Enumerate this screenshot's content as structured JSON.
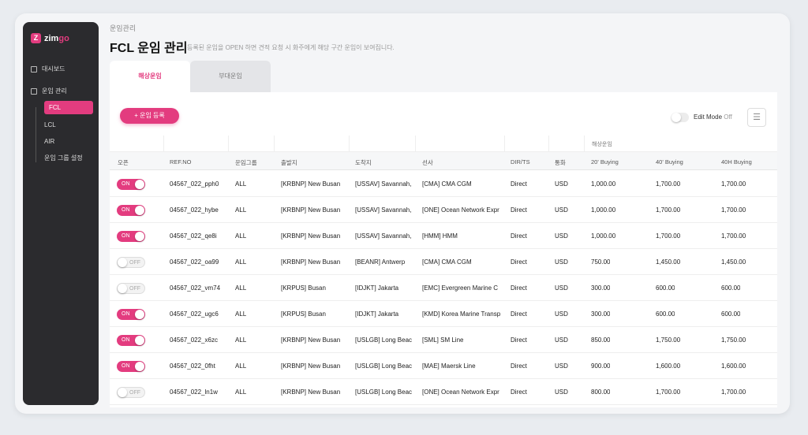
{
  "sidebar": {
    "logo_mark": "Z",
    "logo_text": "zim",
    "logo_suffix": "go",
    "dashboard": "대시보드",
    "rate_mgmt": "운임 관리",
    "sub_items": [
      "FCL",
      "LCL",
      "AIR",
      "운임 그룹 설정"
    ]
  },
  "breadcrumb": "운임관리",
  "title": "FCL 운임 관리",
  "subtitle": "등록된 운임을 OPEN 하면 견적 요청 시 화주에게 해당 구간 운임이 보여집니다.",
  "tabs": [
    "해상운임",
    "부대운임"
  ],
  "add_button": "+ 운임 등록",
  "edit_mode": {
    "label": "Edit Mode",
    "state": "Off"
  },
  "table": {
    "group_header": "해상운임",
    "columns": [
      "오픈",
      "REF.NO",
      "운임그룹",
      "출발지",
      "도착지",
      "선사",
      "DIR/TS",
      "통화",
      "20' Buying",
      "40' Buying",
      "40H Buying"
    ],
    "rows": [
      {
        "open": "ON",
        "ref": "04567_022_pph0",
        "group": "ALL",
        "origin": "[KRBNP] New Busan",
        "dest": "[USSAV] Savannah,",
        "carrier": "[CMA] CMA CGM",
        "dir": "Direct",
        "cur": "USD",
        "b20": "1,000.00",
        "b40": "1,700.00",
        "b40h": "1,700.00"
      },
      {
        "open": "ON",
        "ref": "04567_022_hybe",
        "group": "ALL",
        "origin": "[KRBNP] New Busan",
        "dest": "[USSAV] Savannah,",
        "carrier": "[ONE] Ocean Network Expr",
        "dir": "Direct",
        "cur": "USD",
        "b20": "1,000.00",
        "b40": "1,700.00",
        "b40h": "1,700.00"
      },
      {
        "open": "ON",
        "ref": "04567_022_qe8i",
        "group": "ALL",
        "origin": "[KRBNP] New Busan",
        "dest": "[USSAV] Savannah,",
        "carrier": "[HMM] HMM",
        "dir": "Direct",
        "cur": "USD",
        "b20": "1,000.00",
        "b40": "1,700.00",
        "b40h": "1,700.00"
      },
      {
        "open": "OFF",
        "ref": "04567_022_oa99",
        "group": "ALL",
        "origin": "[KRBNP] New Busan",
        "dest": "[BEANR] Antwerp",
        "carrier": "[CMA] CMA CGM",
        "dir": "Direct",
        "cur": "USD",
        "b20": "750.00",
        "b40": "1,450.00",
        "b40h": "1,450.00"
      },
      {
        "open": "OFF",
        "ref": "04567_022_vm74",
        "group": "ALL",
        "origin": "[KRPUS] Busan",
        "dest": "[IDJKT] Jakarta",
        "carrier": "[EMC] Evergreen Marine C",
        "dir": "Direct",
        "cur": "USD",
        "b20": "300.00",
        "b40": "600.00",
        "b40h": "600.00"
      },
      {
        "open": "ON",
        "ref": "04567_022_ugc6",
        "group": "ALL",
        "origin": "[KRPUS] Busan",
        "dest": "[IDJKT] Jakarta",
        "carrier": "[KMD] Korea Marine Transp",
        "dir": "Direct",
        "cur": "USD",
        "b20": "300.00",
        "b40": "600.00",
        "b40h": "600.00"
      },
      {
        "open": "ON",
        "ref": "04567_022_x6zc",
        "group": "ALL",
        "origin": "[KRBNP] New Busan",
        "dest": "[USLGB] Long Beac",
        "carrier": "[SML] SM Line",
        "dir": "Direct",
        "cur": "USD",
        "b20": "850.00",
        "b40": "1,750.00",
        "b40h": "1,750.00"
      },
      {
        "open": "ON",
        "ref": "04567_022_0fht",
        "group": "ALL",
        "origin": "[KRBNP] New Busan",
        "dest": "[USLGB] Long Beac",
        "carrier": "[MAE] Maersk Line",
        "dir": "Direct",
        "cur": "USD",
        "b20": "900.00",
        "b40": "1,600.00",
        "b40h": "1,600.00"
      },
      {
        "open": "OFF",
        "ref": "04567_022_ln1w",
        "group": "ALL",
        "origin": "[KRBNP] New Busan",
        "dest": "[USLGB] Long Beac",
        "carrier": "[ONE] Ocean Network Expr",
        "dir": "Direct",
        "cur": "USD",
        "b20": "800.00",
        "b40": "1,700.00",
        "b40h": "1,700.00"
      }
    ]
  },
  "colors": {
    "accent": "#e33c7f",
    "sidebar": "#2b2b2e"
  },
  "icons": {
    "dashboard": "grid-icon",
    "rates": "document-icon",
    "settings": "sliders-icon"
  }
}
